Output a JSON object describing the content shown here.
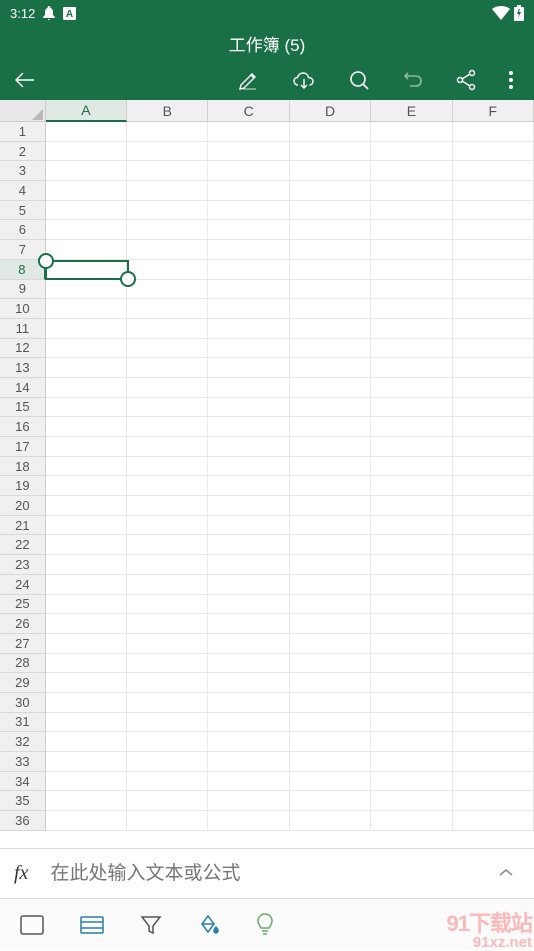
{
  "statusBar": {
    "time": "3:12"
  },
  "header": {
    "title": "工作簿 (5)"
  },
  "spreadsheet": {
    "columns": [
      "A",
      "B",
      "C",
      "D",
      "E",
      "F"
    ],
    "selectedColumn": "A",
    "rowCount": 36,
    "selectedRow": 8,
    "selectedCell": {
      "row": 8,
      "col": "A"
    }
  },
  "formulaBar": {
    "fxLabel": "fx",
    "placeholder": "在此处输入文本或公式"
  },
  "watermark": {
    "line1": "91下载站",
    "line2": "91xz.net"
  }
}
